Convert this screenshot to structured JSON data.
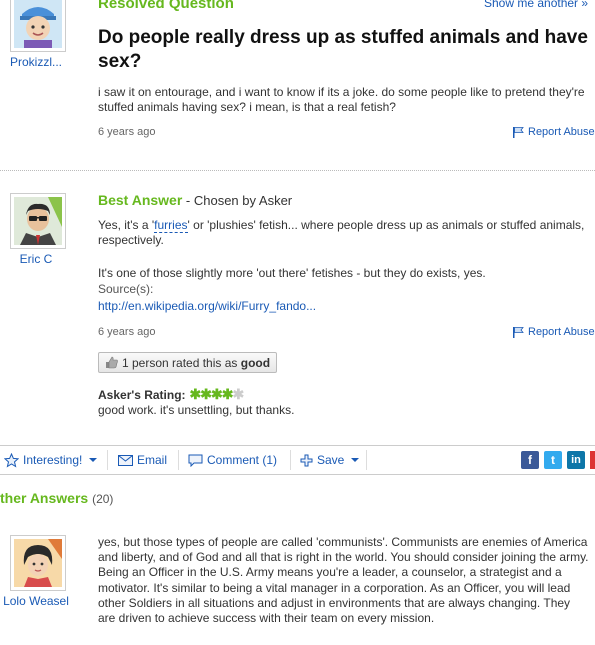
{
  "header": {
    "label": "Resolved Question",
    "show_another": "Show me another »"
  },
  "question": {
    "user": "Prokizzl...",
    "title": "Do people really dress up as stuffed animals and have sex?",
    "details": "i saw it on entourage, and i want to know if its a joke. do some people like to pretend they're stuffed animals having sex? i mean, is that a real fetish?",
    "time": "6 years ago",
    "report": "Report Abuse"
  },
  "best_answer": {
    "heading": "Best Answer",
    "chosen": " - Chosen by Asker",
    "user": "Eric C",
    "text_pre": "Yes, it's a '",
    "text_link": "furries",
    "text_post": "' or 'plushies' fetish... where people dress up as animals or stuffed animals, respectively.",
    "text2": "It's one of those slightly more 'out there' fetishes - but they do exists, yes.",
    "sources_label": "Source(s):",
    "source_link": "http://en.wikipedia.org/wiki/Furry_fando...",
    "time": "6 years ago",
    "report": "Report Abuse",
    "rated_pre": "1 person rated this as ",
    "rated_bold": "good",
    "askers_rating_label": "Asker's Rating:",
    "rating_stars": 4,
    "rating_max": 5,
    "askers_comment": "good work. it's unsettling, but thanks."
  },
  "toolbar": {
    "interesting": "Interesting!",
    "email": "Email",
    "comment": "Comment (1)",
    "save": "Save",
    "social": [
      "f",
      "t",
      "in"
    ]
  },
  "other_answers": {
    "heading": "ther Answers",
    "count": "(20)",
    "first": {
      "user": "Lolo Weasel",
      "text": "yes, but those types of people are called 'communists'. Communists are enemies of America and liberty, and of God and all that is right in the world. You should consider joining the army. Being an Officer in the U.S. Army means you're a leader, a counselor, a strategist and a motivator. It's similar to being a vital manager in a corporation. As an Officer, you will lead other Soldiers in all situations and adjust in environments that are always changing. They are driven to achieve success with their team on every mission."
    }
  },
  "colors": {
    "green": "#66b81e",
    "link": "#1a5ab5",
    "star_on": "#66b81e",
    "star_off": "#cccccc"
  }
}
